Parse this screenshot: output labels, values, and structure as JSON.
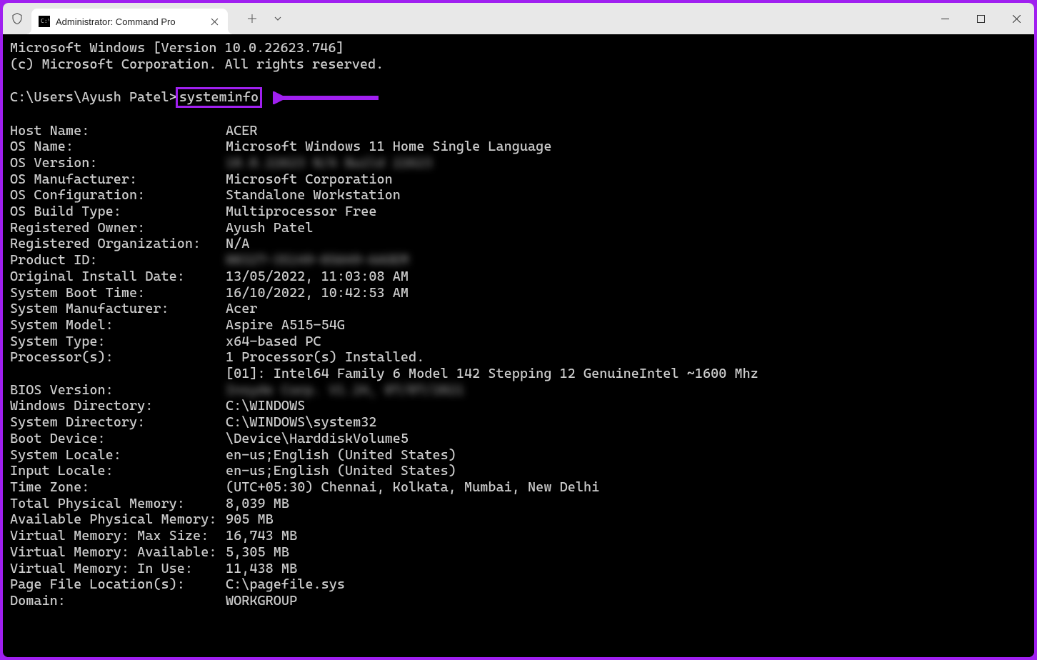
{
  "titlebar": {
    "tab_title": "Administrator: Command Pro"
  },
  "terminal": {
    "header_line1": "Microsoft Windows [Version 10.0.22623.746]",
    "header_line2": "(c) Microsoft Corporation. All rights reserved.",
    "prompt": "C:\\Users\\Ayush Patel>",
    "command": "systeminfo",
    "rows": [
      {
        "label": "Host Name:",
        "value": "ACER",
        "blurred": false
      },
      {
        "label": "OS Name:",
        "value": "Microsoft Windows 11 Home Single Language",
        "blurred": false
      },
      {
        "label": "OS Version:",
        "value": "10.0.22623 N/A Build 22623",
        "blurred": true
      },
      {
        "label": "OS Manufacturer:",
        "value": "Microsoft Corporation",
        "blurred": false
      },
      {
        "label": "OS Configuration:",
        "value": "Standalone Workstation",
        "blurred": false
      },
      {
        "label": "OS Build Type:",
        "value": "Multiprocessor Free",
        "blurred": false
      },
      {
        "label": "Registered Owner:",
        "value": "Ayush Patel",
        "blurred": false
      },
      {
        "label": "Registered Organization:",
        "value": "N/A",
        "blurred": false
      },
      {
        "label": "Product ID:",
        "value": "00327-35149-85649-AAOEM",
        "blurred": true
      },
      {
        "label": "Original Install Date:",
        "value": "13/05/2022, 11:03:08 AM",
        "blurred": false
      },
      {
        "label": "System Boot Time:",
        "value": "16/10/2022, 10:42:53 AM",
        "blurred": false
      },
      {
        "label": "System Manufacturer:",
        "value": "Acer",
        "blurred": false
      },
      {
        "label": "System Model:",
        "value": "Aspire A515-54G",
        "blurred": false
      },
      {
        "label": "System Type:",
        "value": "x64-based PC",
        "blurred": false
      },
      {
        "label": "Processor(s):",
        "value": "1 Processor(s) Installed.",
        "blurred": false
      },
      {
        "label": "",
        "value": "[01]: Intel64 Family 6 Model 142 Stepping 12 GenuineIntel ~1600 Mhz",
        "blurred": false
      },
      {
        "label": "BIOS Version:",
        "value": "Insyde Corp. V1.24, 07/07/2021",
        "blurred": true
      },
      {
        "label": "Windows Directory:",
        "value": "C:\\WINDOWS",
        "blurred": false
      },
      {
        "label": "System Directory:",
        "value": "C:\\WINDOWS\\system32",
        "blurred": false
      },
      {
        "label": "Boot Device:",
        "value": "\\Device\\HarddiskVolume5",
        "blurred": false
      },
      {
        "label": "System Locale:",
        "value": "en-us;English (United States)",
        "blurred": false
      },
      {
        "label": "Input Locale:",
        "value": "en-us;English (United States)",
        "blurred": false
      },
      {
        "label": "Time Zone:",
        "value": "(UTC+05:30) Chennai, Kolkata, Mumbai, New Delhi",
        "blurred": false
      },
      {
        "label": "Total Physical Memory:",
        "value": "8,039 MB",
        "blurred": false
      },
      {
        "label": "Available Physical Memory:",
        "value": "905 MB",
        "blurred": false
      },
      {
        "label": "Virtual Memory: Max Size:",
        "value": "16,743 MB",
        "blurred": false
      },
      {
        "label": "Virtual Memory: Available:",
        "value": "5,305 MB",
        "blurred": false
      },
      {
        "label": "Virtual Memory: In Use:",
        "value": "11,438 MB",
        "blurred": false
      },
      {
        "label": "Page File Location(s):",
        "value": "C:\\pagefile.sys",
        "blurred": false
      },
      {
        "label": "Domain:",
        "value": "WORKGROUP",
        "blurred": false
      }
    ]
  }
}
